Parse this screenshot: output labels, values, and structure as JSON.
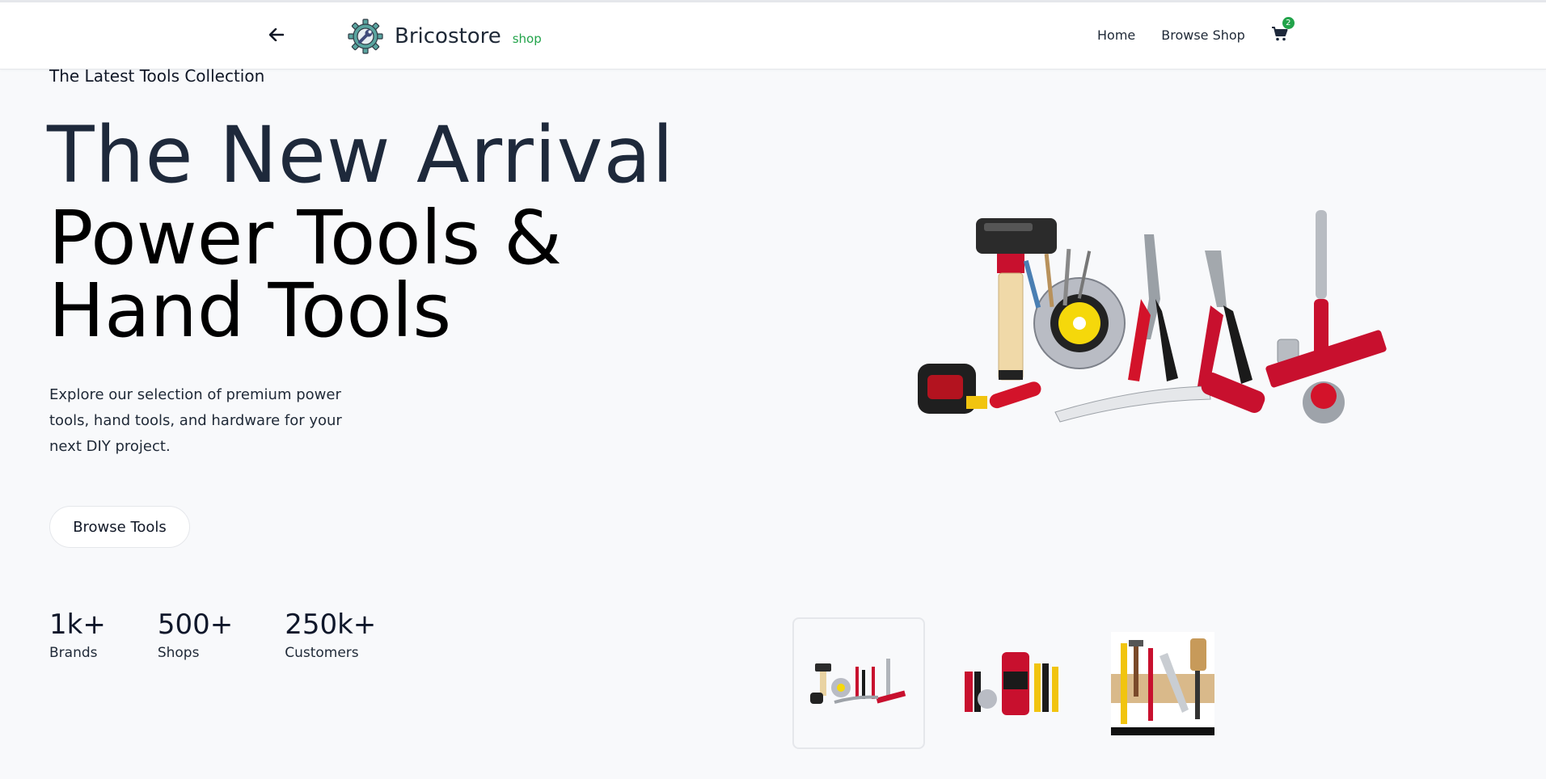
{
  "header": {
    "brand_name": "Bricostore",
    "brand_tag": "shop",
    "nav": [
      {
        "label": "Home"
      },
      {
        "label": "Browse Shop"
      }
    ],
    "cart_count": "2",
    "accent_color": "#22a34a"
  },
  "hero": {
    "eyebrow": "The Latest Tools Collection",
    "headline_line1": "The New Arrival",
    "headline_line2": "Power Tools &",
    "headline_line3": "Hand Tools",
    "description": "Explore our selection of premium power tools, hand tools, and hardware for your next DIY project.",
    "cta_label": "Browse Tools"
  },
  "stats": [
    {
      "value": "1k+",
      "label": "Brands"
    },
    {
      "value": "500+",
      "label": "Shops"
    },
    {
      "value": "250k+",
      "label": "Customers"
    }
  ],
  "thumbnails": {
    "selected_index": 0
  }
}
